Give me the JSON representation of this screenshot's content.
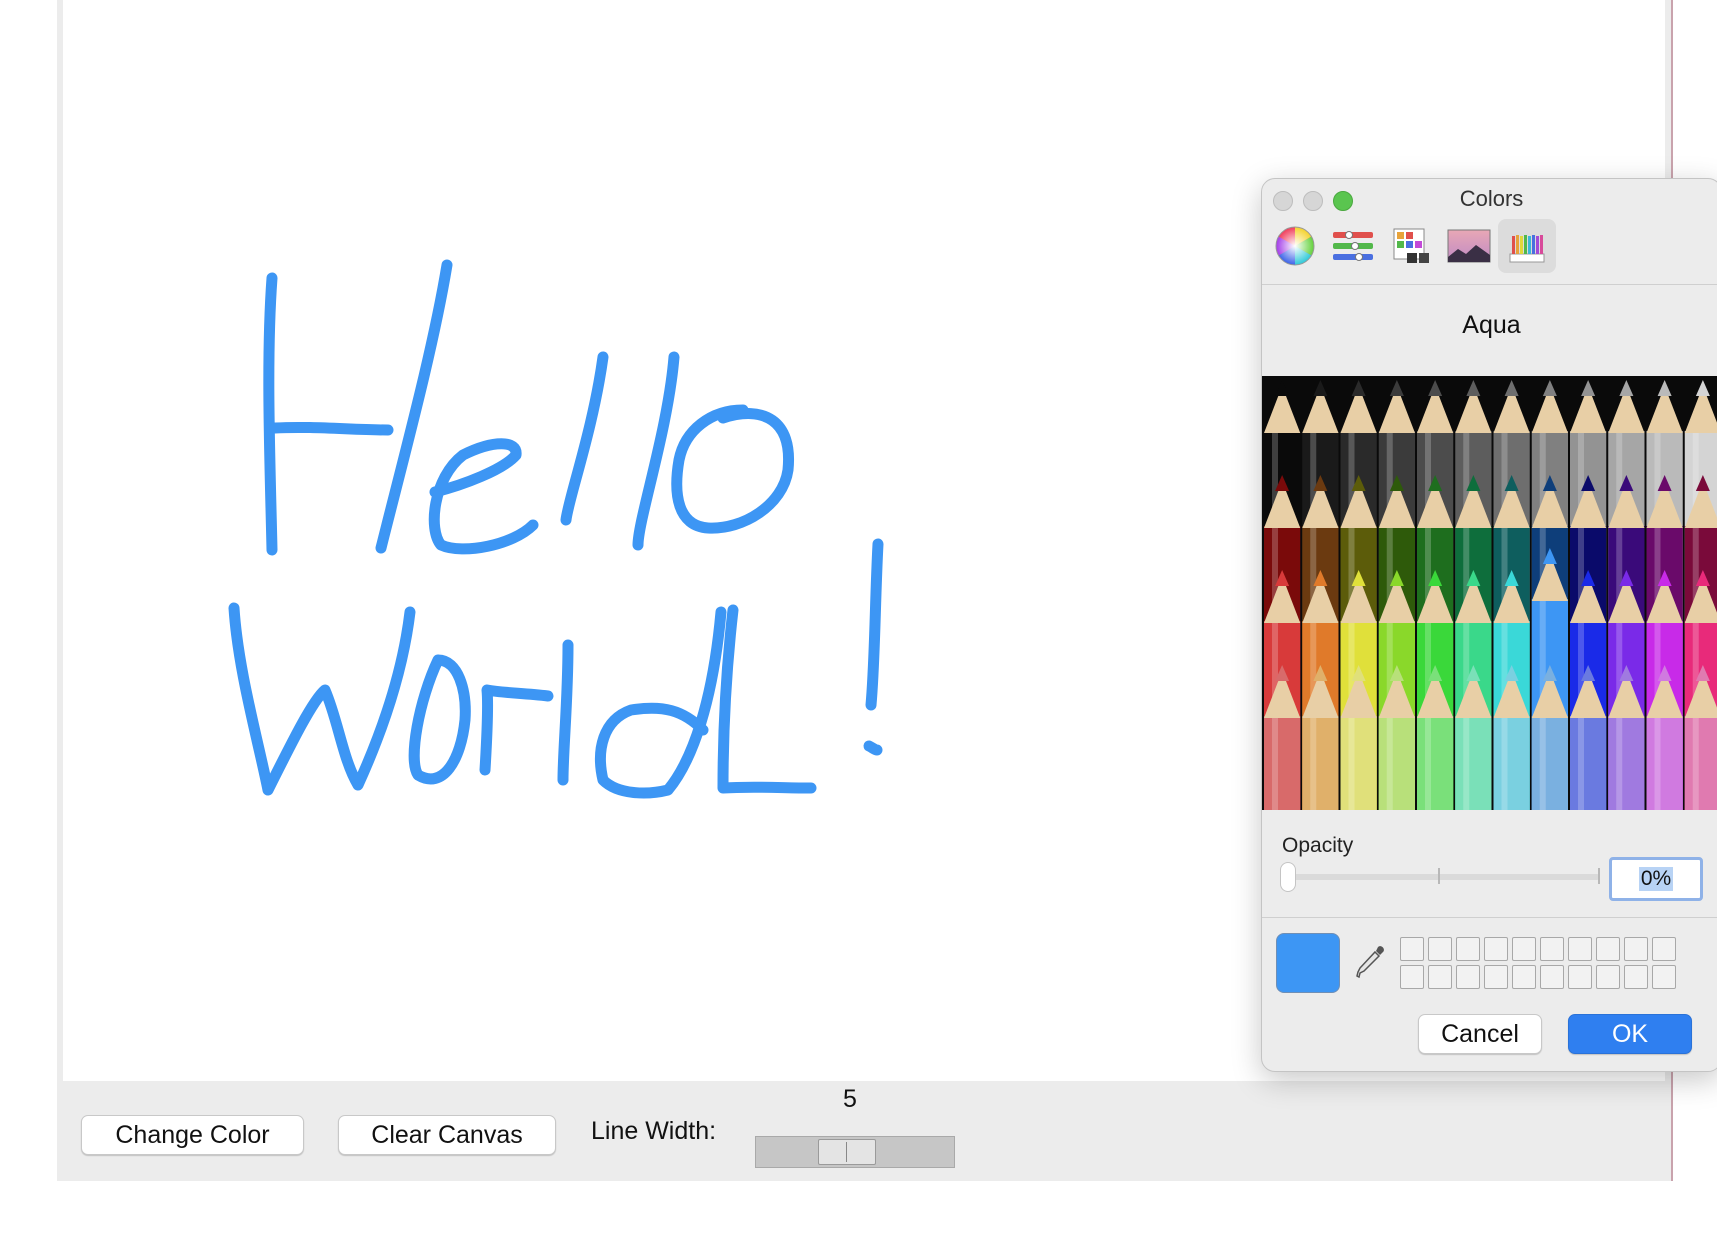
{
  "canvas": {
    "drawn_text": "Hello World!",
    "stroke_color": "#3d96f4",
    "line_width": 5
  },
  "toolbar": {
    "change_color_label": "Change Color",
    "clear_canvas_label": "Clear Canvas",
    "line_width_label": "Line Width:",
    "line_width_value": "5"
  },
  "colors_panel": {
    "title": "Colors",
    "modes": [
      "color-wheel-icon",
      "sliders-icon",
      "palettes-icon",
      "image-palettes-icon",
      "pencils-icon"
    ],
    "active_mode": "pencils-icon",
    "selected_color_name": "Aqua",
    "opacity_label": "Opacity",
    "opacity_value": "0%",
    "current_color": "#3d96f4",
    "cancel_label": "Cancel",
    "ok_label": "OK",
    "pencil_rows": [
      [
        "#0a0a0a",
        "#1a1a1a",
        "#2a2a2a",
        "#3b3b3b",
        "#4c4c4c",
        "#5d5d5d",
        "#6e6e6e",
        "#808080",
        "#939393",
        "#a6a6a6",
        "#bababa",
        "#d4d4d4"
      ],
      [
        "#7a0a0a",
        "#6b3a10",
        "#5c5c0a",
        "#2e5a0a",
        "#1e6e1e",
        "#0e6e3c",
        "#0e5e5e",
        "#0e3e7a",
        "#0a0a6a",
        "#3a0a7a",
        "#6a0a6a",
        "#7a0a3a"
      ],
      [
        "#d83a3a",
        "#e07a2a",
        "#e0e03a",
        "#8ad82a",
        "#3ad83a",
        "#3ad88a",
        "#3ad8d8",
        "#3d96f4",
        "#1a2ae8",
        "#7a2ae8",
        "#c82ae8",
        "#e82a7a"
      ],
      [
        "#d86a6a",
        "#e0b06a",
        "#e0e07a",
        "#b8e07a",
        "#7ae07a",
        "#7ae0b8",
        "#7ad0e0",
        "#7ab0e0",
        "#6a7ae0",
        "#a07ae0",
        "#d07ae0",
        "#e07ab0"
      ]
    ]
  }
}
